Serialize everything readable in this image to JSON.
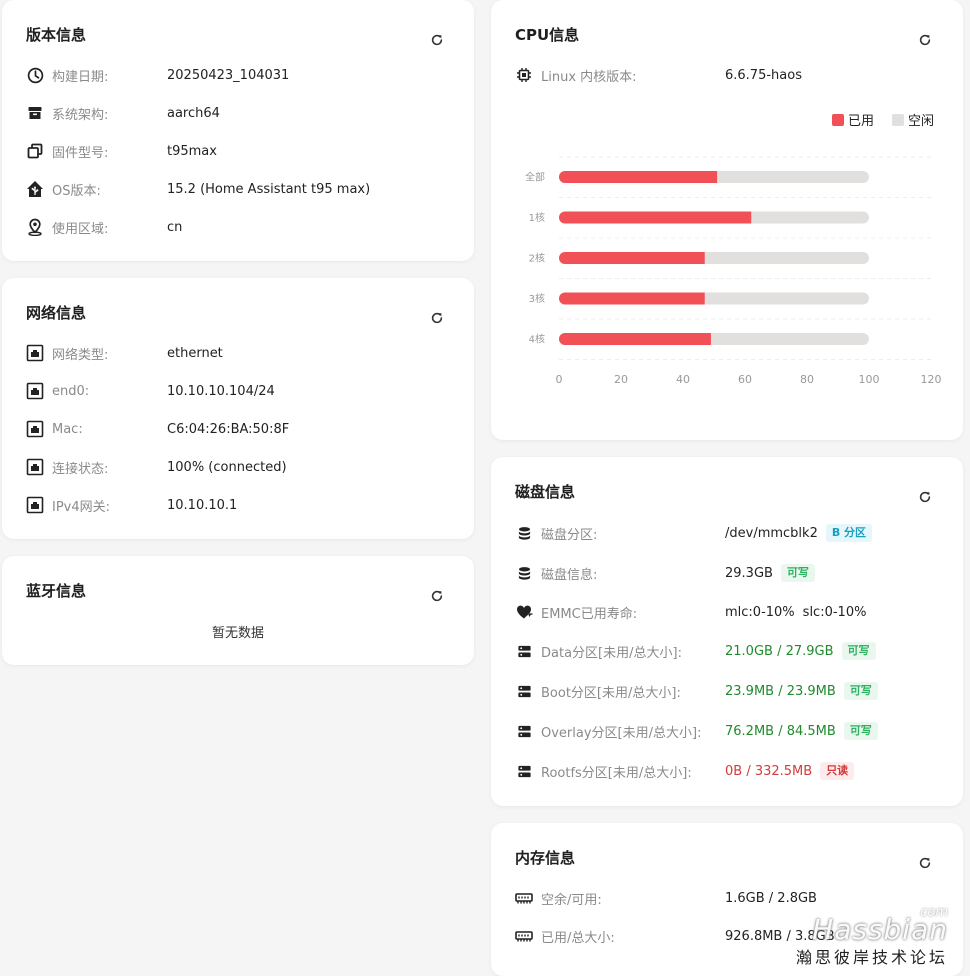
{
  "version": {
    "title": "版本信息",
    "rows": [
      {
        "label": "构建日期:",
        "value": "20250423_104031"
      },
      {
        "label": "系统架构:",
        "value": "aarch64"
      },
      {
        "label": "固件型号:",
        "value": "t95max"
      },
      {
        "label": "OS版本:",
        "value": "15.2 (Home Assistant t95 max)"
      },
      {
        "label": "使用区域:",
        "value": "cn"
      }
    ]
  },
  "network": {
    "title": "网络信息",
    "rows": [
      {
        "label": "网络类型:",
        "value": "ethernet"
      },
      {
        "label": "end0:",
        "value": "10.10.10.104/24"
      },
      {
        "label": "Mac:",
        "value": "C6:04:26:BA:50:8F"
      },
      {
        "label": "连接状态:",
        "value": "100% (connected)"
      },
      {
        "label": "IPv4网关:",
        "value": "10.10.10.1"
      }
    ]
  },
  "bluetooth": {
    "title": "蓝牙信息",
    "empty": "暂无数据"
  },
  "cpu": {
    "title": "CPU信息",
    "kernel_label": "Linux 内核版本:",
    "kernel_value": "6.6.75-haos",
    "legend_used": "已用",
    "legend_idle": "空闲",
    "colors": {
      "used": "#f05056",
      "idle": "#e2dfdf"
    }
  },
  "chart_data": {
    "type": "bar",
    "orientation": "horizontal",
    "categories": [
      "全部",
      "1核",
      "2核",
      "3核",
      "4核"
    ],
    "series": [
      {
        "name": "已用",
        "values": [
          51,
          62,
          47,
          47,
          49
        ]
      },
      {
        "name": "空闲",
        "values": [
          49,
          38,
          53,
          53,
          51
        ]
      }
    ],
    "stacked": true,
    "xlim": [
      0,
      120
    ],
    "xticks": [
      "0",
      "20",
      "40",
      "60",
      "80",
      "100",
      "120"
    ],
    "legend": "top-right",
    "grid": "dashed-horizontal"
  },
  "disk": {
    "title": "磁盘信息",
    "rows": [
      {
        "label": "磁盘分区:",
        "value": "/dev/mmcblk2",
        "badge": "B 分区"
      },
      {
        "label": "磁盘信息:",
        "value": "29.3GB",
        "badge": "可写"
      },
      {
        "label": "EMMC已用寿命:",
        "value": "mlc:0-10%",
        "value2": "slc:0-10%"
      },
      {
        "label": "Data分区[未用/总大小]:",
        "value": "21.0GB / 27.9GB",
        "badge": "可写"
      },
      {
        "label": "Boot分区[未用/总大小]:",
        "value": "23.9MB / 23.9MB",
        "badge": "可写"
      },
      {
        "label": "Overlay分区[未用/总大小]:",
        "value": "76.2MB / 84.5MB",
        "badge": "可写"
      },
      {
        "label": "Rootfs分区[未用/总大小]:",
        "value": "0B / 332.5MB",
        "badge": "只读"
      }
    ]
  },
  "memory": {
    "title": "内存信息",
    "rows": [
      {
        "label": "空余/可用:",
        "value": "1.6GB / 2.8GB"
      },
      {
        "label": "已用/总大小:",
        "value": "926.8MB / 3.8GB"
      }
    ]
  },
  "watermark": {
    "brand": "Hassbian",
    "domain": "com",
    "cn": "瀚思彼岸技术论坛"
  }
}
